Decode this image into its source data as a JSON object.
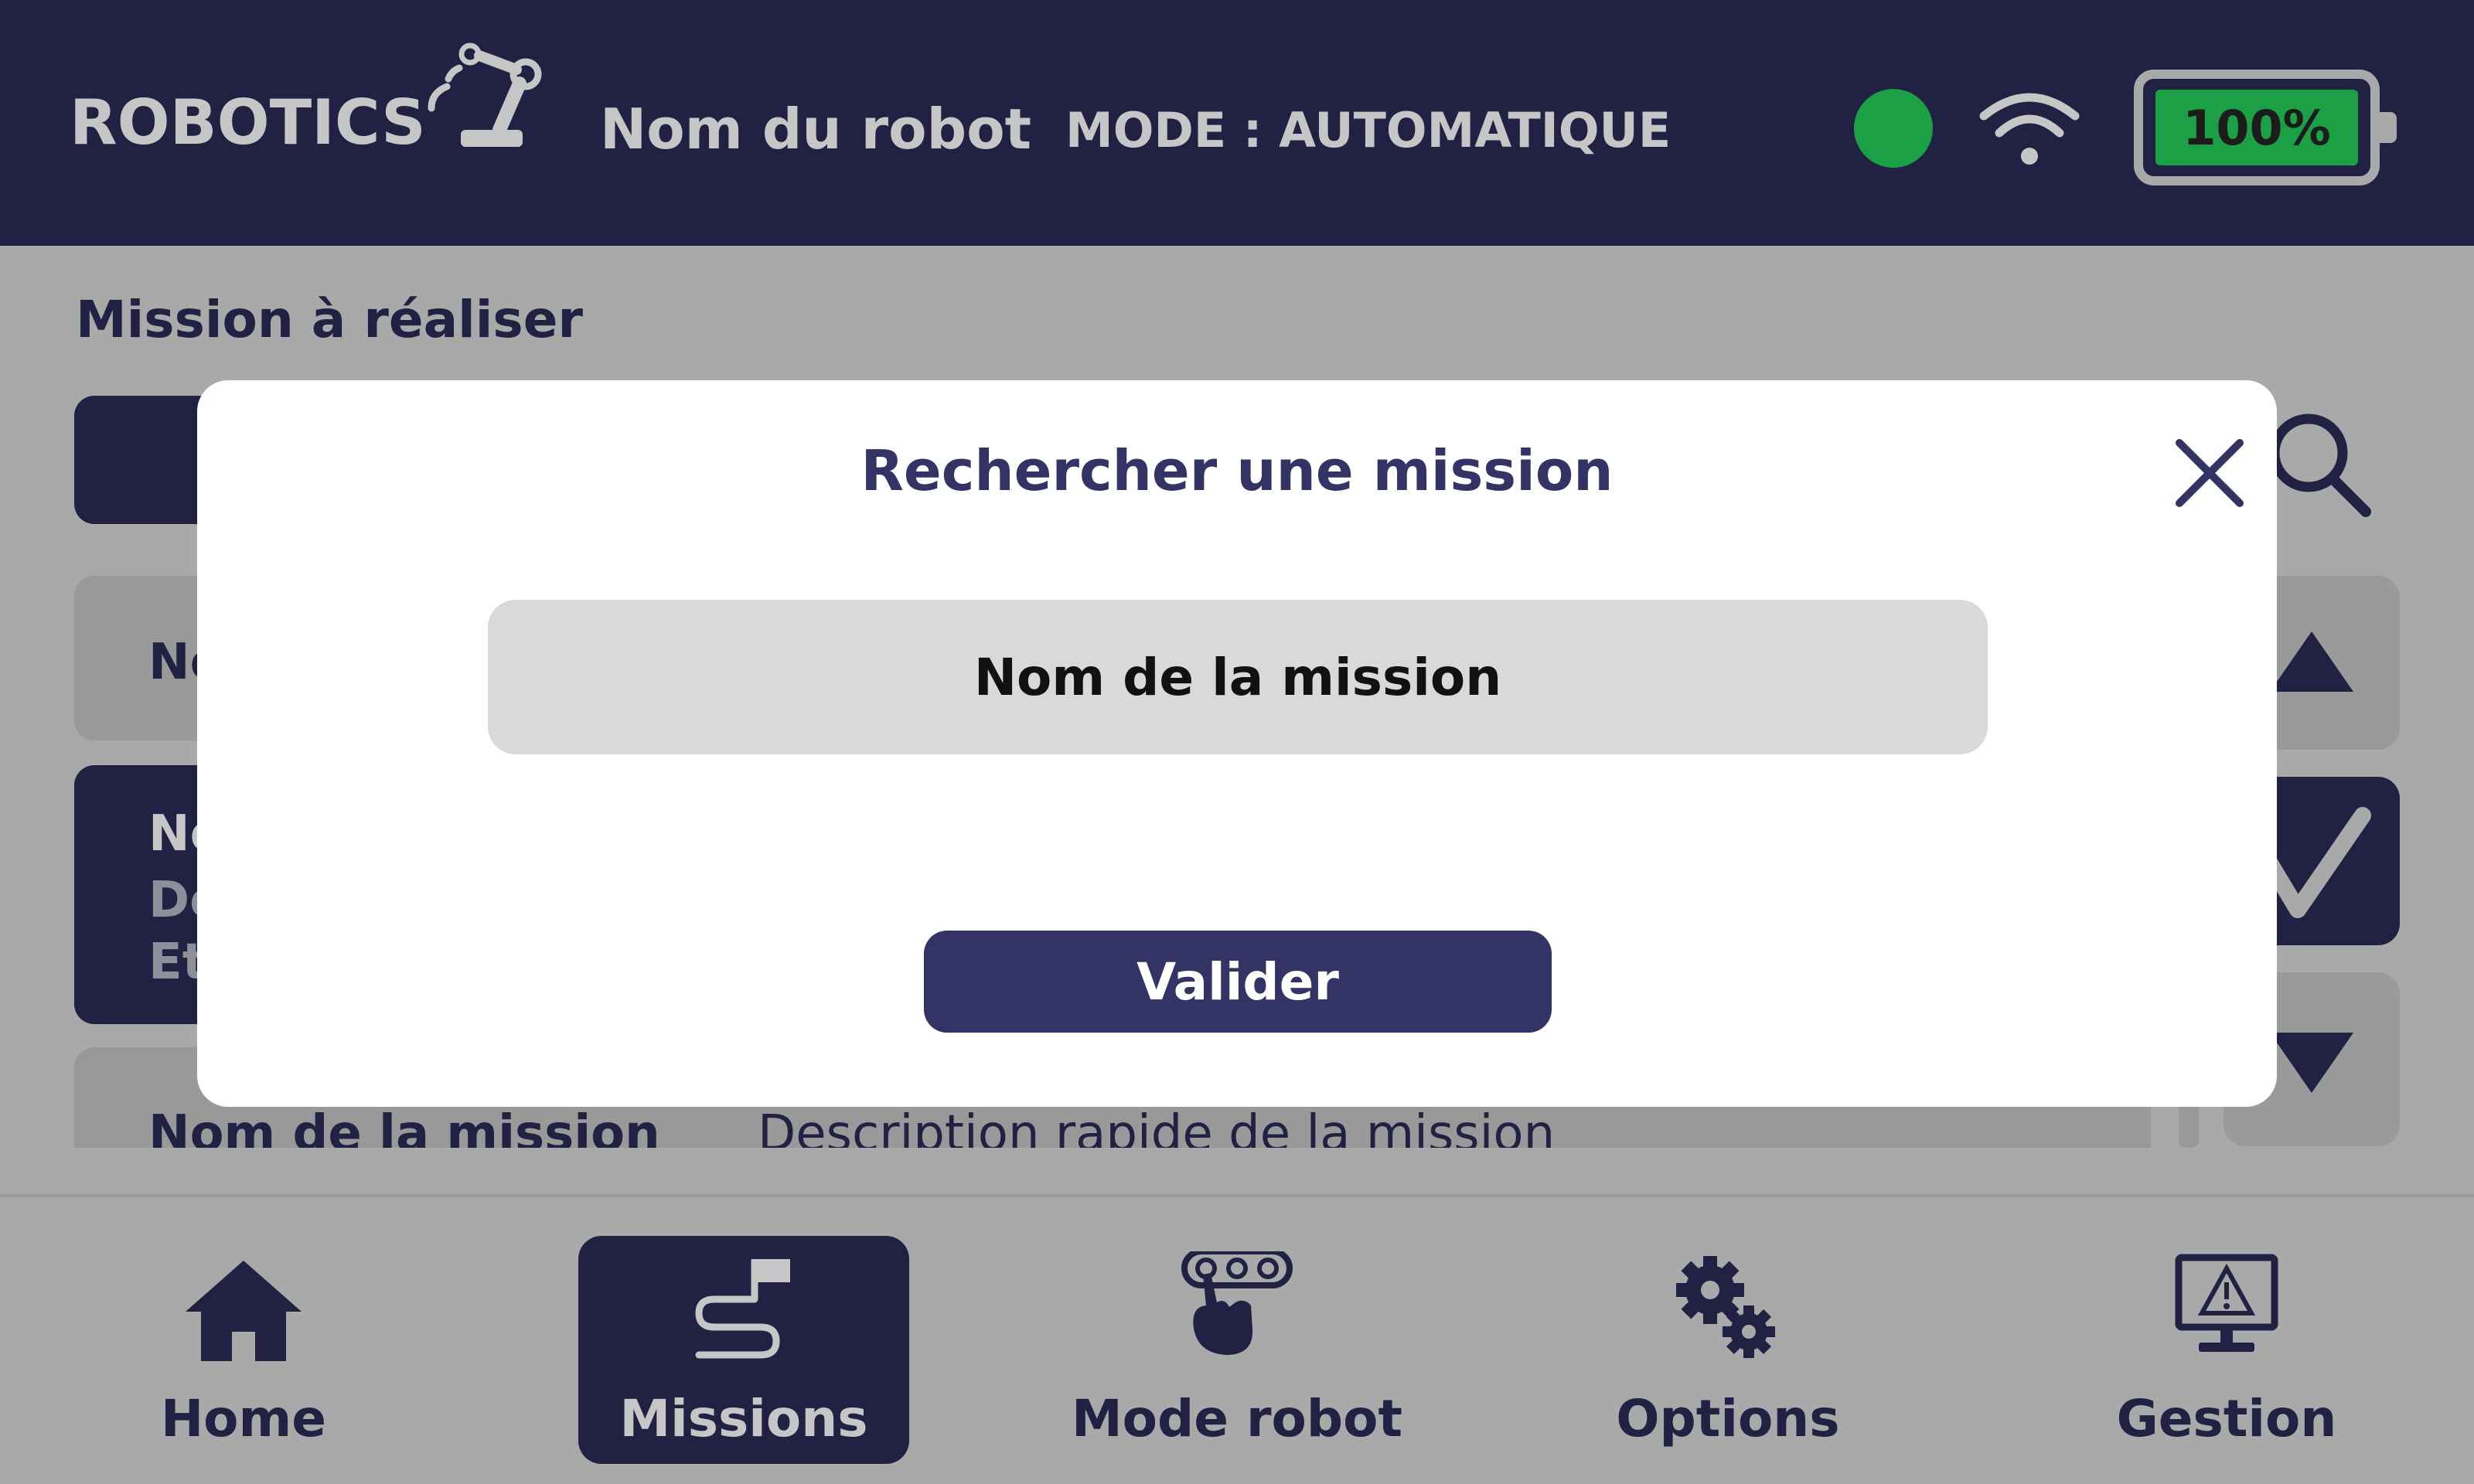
{
  "header": {
    "brand": "ROBOTICS",
    "robot_name": "Nom du robot",
    "mode": "MODE : AUTOMATIQUE",
    "battery": "100%",
    "battery_level": 1.0,
    "status_color": "#1ca046"
  },
  "background": {
    "section_title": "Mission à réaliser",
    "rows": [
      {
        "name_partial": "No"
      },
      {
        "name_partial": "No",
        "line2_partial": "De",
        "line3_partial": "Et"
      },
      {
        "name": "Nom de la mission",
        "description": "Description rapide de la mission"
      }
    ]
  },
  "modal": {
    "title": "Rechercher une mission",
    "input_placeholder": "Nom de la mission",
    "input_value": "",
    "validate_label": "Valider"
  },
  "nav": [
    {
      "label": "Home",
      "icon": "home-icon"
    },
    {
      "label": "Missions",
      "icon": "mission-flag-icon",
      "active": true
    },
    {
      "label": "Mode robot",
      "icon": "robot-mode-icon"
    },
    {
      "label": "Options",
      "icon": "gears-icon"
    },
    {
      "label": "Gestion",
      "icon": "monitor-warning-icon"
    }
  ],
  "colors": {
    "primary": "#202143",
    "accent": "#333366",
    "success": "#1ca046",
    "overlay": "#a9a9a9"
  }
}
